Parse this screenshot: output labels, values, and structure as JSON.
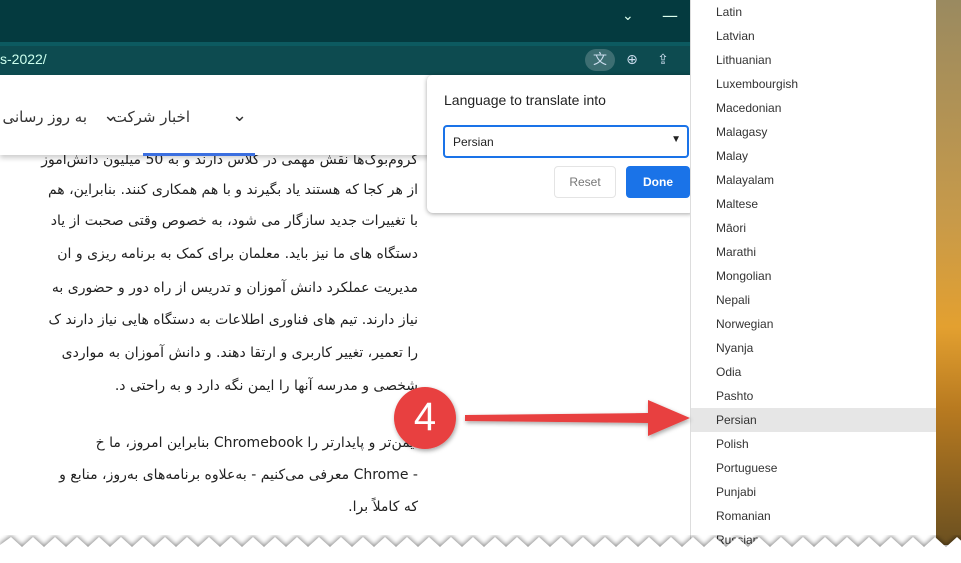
{
  "browser": {
    "url": "s-2022/"
  },
  "nav": {
    "items": [
      {
        "label": "اخبار شرکت"
      },
      {
        "label": "به روز رسانی"
      }
    ]
  },
  "article": {
    "lines": [
      "کروم‌بوک‌ها نقش مهمی در کلاس دارند و به 50 میلیون دانش‌آموز",
      "از هر کجا که هستند یاد بگیرند و با هم همکاری کنند. بنابراین، هم",
      "با تغییرات جدید سازگار می شود، به خصوص وقتی صحبت از یاد",
      "دستگاه های ما نیز باید. معلمان برای کمک به برنامه ریزی و ان",
      "مدیریت عملکرد دانش آموزان و تدریس از راه دور و حضوری به",
      "نیاز دارند. تیم های فناوری اطلاعات به دستگاه هایی نیاز دارند ک",
      "را تعمیر، تغییر کاربری و ارتقا دهند. و دانش آموزان به مواردی",
      "شخصی و مدرسه آنها را ایمن نگه دارد و به راحتی د.",
      "ایمن‌تر و پایدارتر را Chromebook بنابراین امروز، ما خ",
      "- Chrome معرفی می‌کنیم - به‌علاوه برنامه‌های به‌روز، منابع و",
      "که کاملاً برا."
    ]
  },
  "dialog": {
    "title": "Language to translate into",
    "selected": "Persian",
    "reset": "Reset",
    "done": "Done"
  },
  "languages": [
    "Latin",
    "Latvian",
    "Lithuanian",
    "Luxembourgish",
    "Macedonian",
    "Malagasy",
    "Malay",
    "Malayalam",
    "Maltese",
    "Māori",
    "Marathi",
    "Mongolian",
    "Nepali",
    "Norwegian",
    "Nyanja",
    "Odia",
    "Pashto",
    "Persian",
    "Polish",
    "Portuguese",
    "Punjabi",
    "Romanian",
    "Russian"
  ],
  "highlighted_language": "Persian",
  "annotation": {
    "step": "4",
    "color": "#e8403f"
  },
  "colors": {
    "titlebar": "#043a3f",
    "addressbar": "#0d4b50",
    "accent": "#1a73e8"
  }
}
